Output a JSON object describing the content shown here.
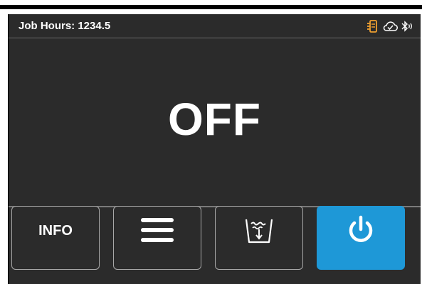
{
  "status_bar": {
    "job_hours_text": "Job Hours: 1234.5",
    "icons": [
      "filter-status-icon",
      "cloud-check-icon",
      "bluetooth-icon"
    ]
  },
  "main": {
    "state_text": "OFF"
  },
  "buttons": {
    "info_label": "INFO",
    "menu_icon": "hamburger-menu-icon",
    "drain_icon": "drain-basin-icon",
    "power_icon": "power-icon"
  },
  "colors": {
    "background": "#2b2b2b",
    "text": "#ffffff",
    "accent": "#1e98d7",
    "filter_icon": "#f0a030"
  }
}
